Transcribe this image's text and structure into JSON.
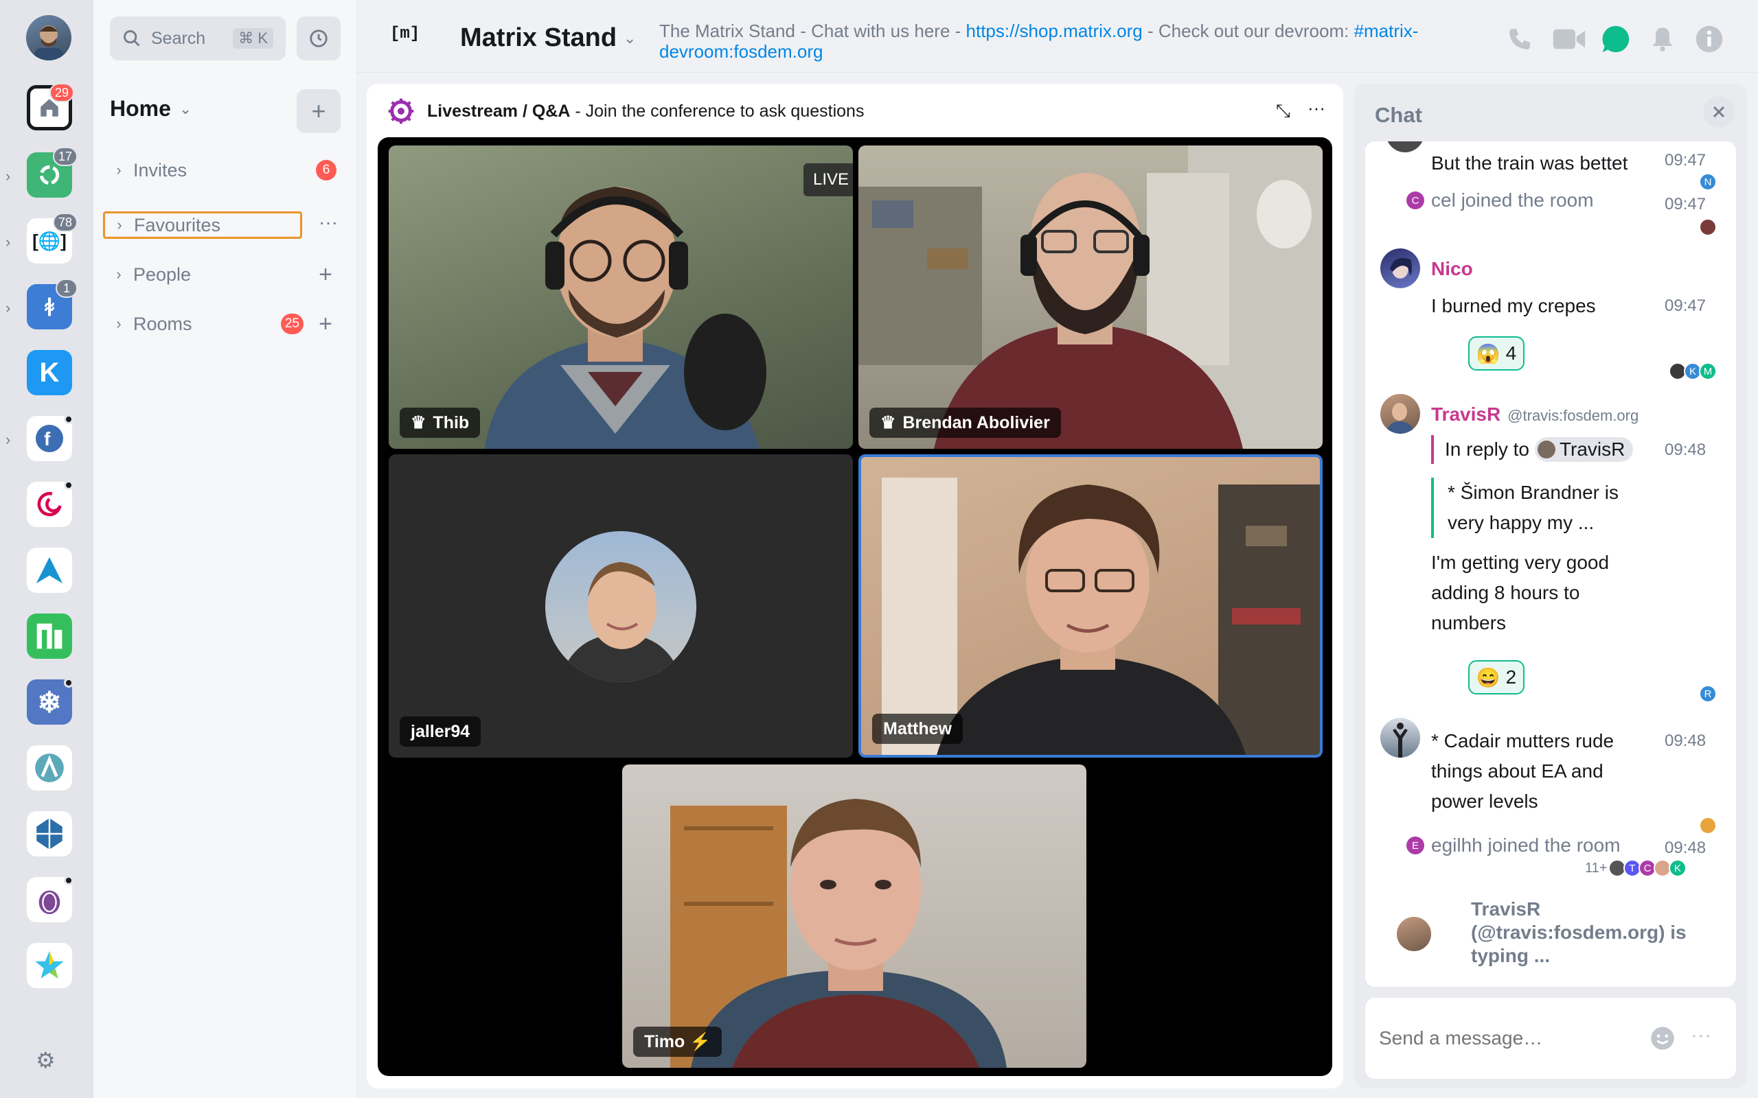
{
  "spaces": {
    "items": [
      {
        "name": "home",
        "badge": "29"
      },
      {
        "name": "matrix",
        "badge": "17"
      },
      {
        "name": "fosdem",
        "badge": "78"
      },
      {
        "name": "gnome",
        "badge": "1"
      },
      {
        "name": "kde"
      },
      {
        "name": "fedora"
      },
      {
        "name": "debian"
      },
      {
        "name": "arch"
      },
      {
        "name": "manjaro"
      },
      {
        "name": "nixos"
      },
      {
        "name": "arco"
      },
      {
        "name": "element"
      },
      {
        "name": "tor"
      },
      {
        "name": "misc"
      }
    ]
  },
  "search": {
    "label": "Search",
    "shortcut": "⌘ K"
  },
  "roomlist": {
    "home_label": "Home",
    "sections": [
      {
        "label": "Invites",
        "count": "6"
      },
      {
        "label": "Favourites"
      },
      {
        "label": "People"
      },
      {
        "label": "Rooms",
        "count": "25"
      }
    ]
  },
  "room": {
    "name": "Matrix Stand",
    "topic_prefix": "The Matrix Stand - Chat with us here - ",
    "topic_link1": "https://shop.matrix.org",
    "topic_mid": " - Check out our devroom: ",
    "topic_link2": "#matrix-devroom:fosdem.org"
  },
  "call": {
    "title": "Livestream / Q&A",
    "subtitle": " - Join the conference to ask questions",
    "live_label": "LIVE",
    "participants": [
      {
        "name": "Thib"
      },
      {
        "name": "Brendan Abolivier"
      },
      {
        "name": "jaller94"
      },
      {
        "name": "Matthew"
      },
      {
        "name": "Timo ⚡"
      }
    ]
  },
  "chat": {
    "title": "Chat",
    "messages": [
      {
        "text": "But the train was bettet",
        "time": "09:47"
      },
      {
        "event": "cel joined the room",
        "time": "09:47"
      },
      {
        "sender": "Nico",
        "text": "I burned my crepes",
        "time": "09:47",
        "reaction": "😱",
        "reaction_count": "4"
      },
      {
        "sender": "TravisR",
        "sender_id": "@travis:fosdem.org",
        "reply_prefix": "In reply to",
        "reply_to": "TravisR",
        "time": "09:48",
        "quote": "* Šimon Brandner is very happy my ...",
        "text": "I'm getting very good adding 8 hours to numbers",
        "reaction": "😄",
        "reaction_count": "2"
      },
      {
        "text": "* Cadair mutters rude things about EA and power levels",
        "time": "09:48"
      },
      {
        "event": "egilhh joined the room",
        "time": "09:48",
        "more": "11+"
      }
    ],
    "typing": "TravisR (@travis:fosdem.org) is typing ...",
    "composer_placeholder": "Send a message…"
  },
  "colors": {
    "accent": "#0dbd8b",
    "link": "#0086e6",
    "badge": "#ff5b55",
    "sender": "#c8388f"
  }
}
